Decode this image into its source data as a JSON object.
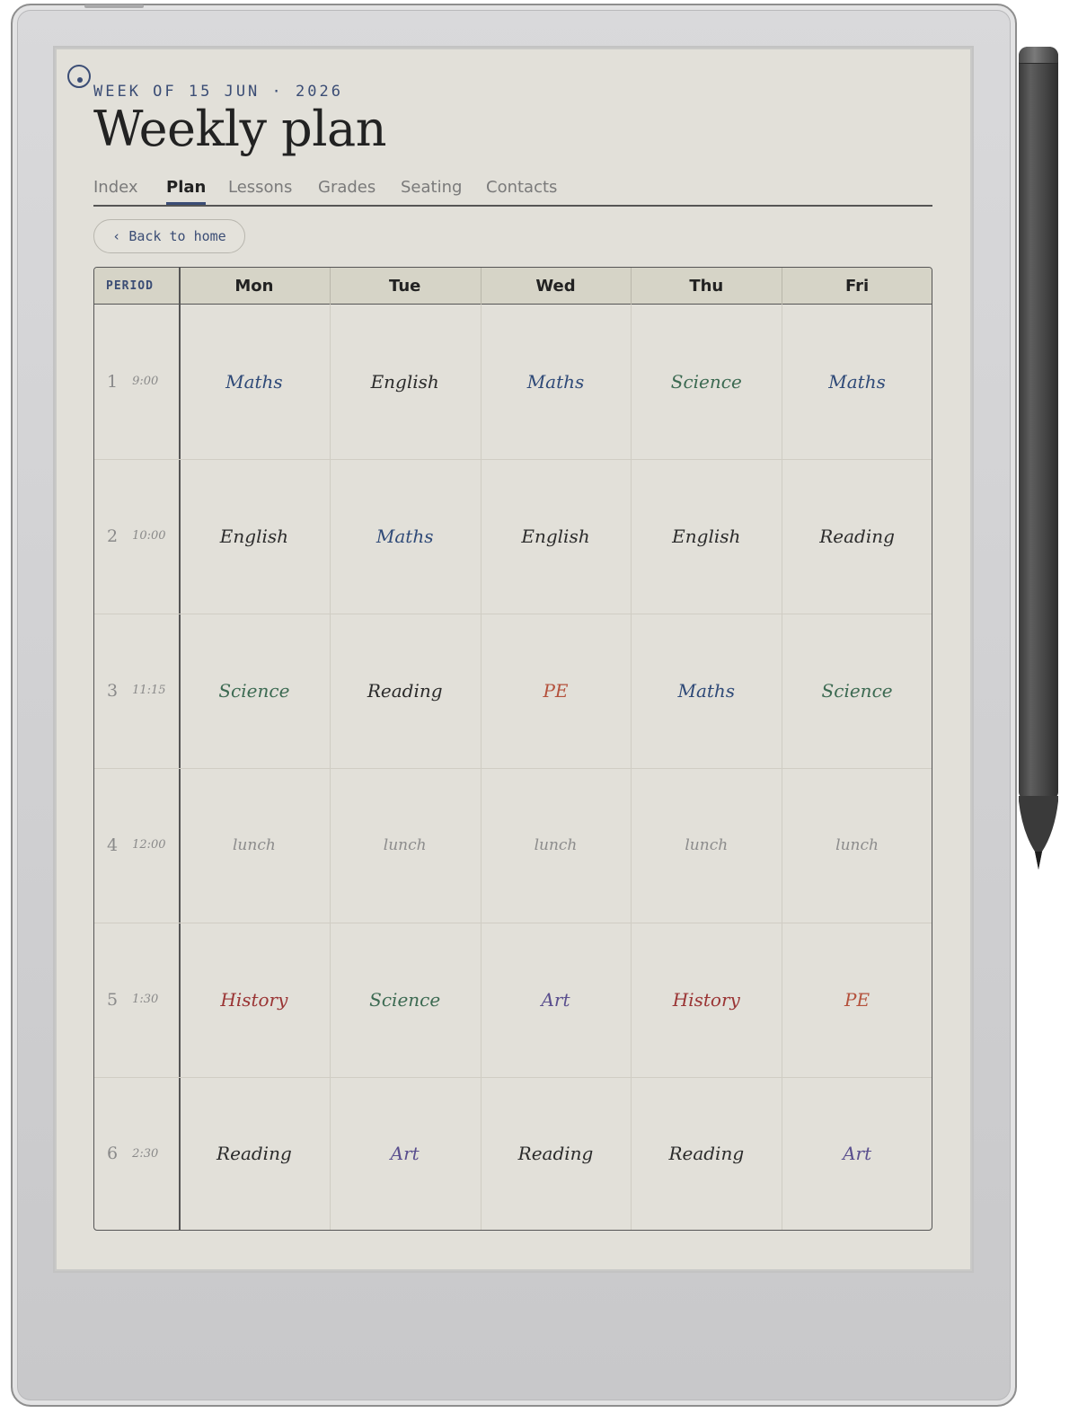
{
  "header": {
    "eyebrow": "WEEK OF 15 JUN · 2026",
    "title": "Weekly plan"
  },
  "tabs": [
    {
      "label": "Index",
      "active": false
    },
    {
      "label": "Plan",
      "active": true
    },
    {
      "label": "Lessons",
      "active": false
    },
    {
      "label": "Grades",
      "active": false
    },
    {
      "label": "Seating",
      "active": false
    },
    {
      "label": "Contacts",
      "active": false
    }
  ],
  "back_button": {
    "icon": "chevron-left-icon",
    "label": "‹ Back to home"
  },
  "timetable": {
    "period_header": "PERIOD",
    "days": [
      "Mon",
      "Tue",
      "Wed",
      "Thu",
      "Fri"
    ],
    "rows": [
      {
        "period": "1",
        "time": "9:00",
        "cells": [
          "Maths",
          "English",
          "Maths",
          "Science",
          "Maths"
        ]
      },
      {
        "period": "2",
        "time": "10:00",
        "cells": [
          "English",
          "Maths",
          "English",
          "English",
          "Reading"
        ]
      },
      {
        "period": "3",
        "time": "11:15",
        "cells": [
          "Science",
          "Reading",
          "PE",
          "Maths",
          "Science"
        ]
      },
      {
        "period": "4",
        "time": "12:00",
        "cells": [
          "lunch",
          "lunch",
          "lunch",
          "lunch",
          "lunch"
        ]
      },
      {
        "period": "5",
        "time": "1:30",
        "cells": [
          "History",
          "Science",
          "Art",
          "History",
          "PE"
        ]
      },
      {
        "period": "6",
        "time": "2:30",
        "cells": [
          "Reading",
          "Art",
          "Reading",
          "Reading",
          "Art"
        ]
      }
    ]
  },
  "subject_colors": {
    "Maths": "#2f4a78",
    "English": "#2b2b2b",
    "Science": "#3c6a52",
    "Reading": "#2b2b2b",
    "PE": "#b4513c",
    "lunch": "#8c8c8c",
    "History": "#9a3434",
    "Art": "#5a4f8e"
  },
  "colors": {
    "accent": "#3b4d75",
    "paper": "#e2e0d9",
    "header_fill": "#d6d4c7"
  }
}
